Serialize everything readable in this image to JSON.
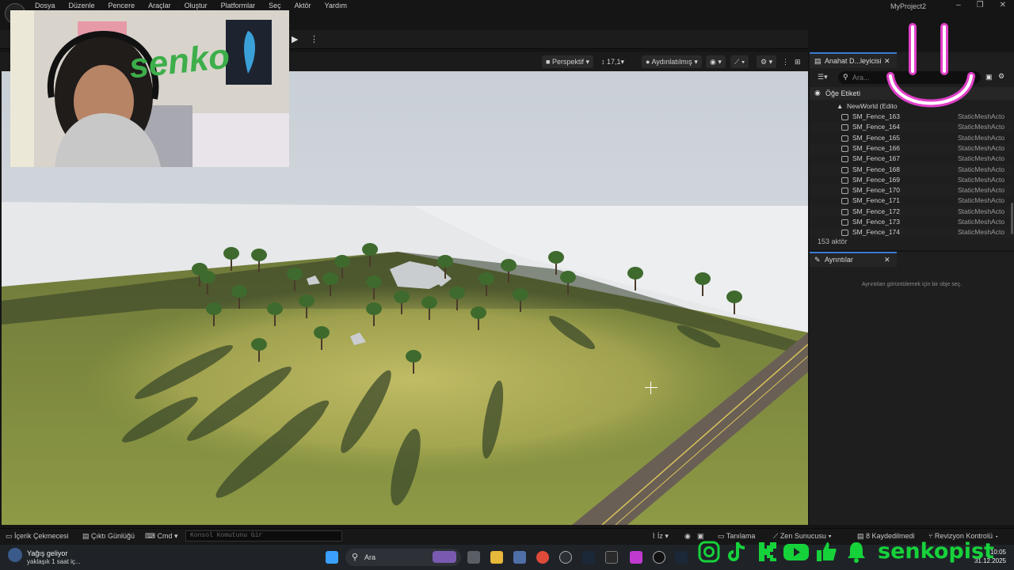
{
  "menu": [
    "Dosya",
    "Düzenle",
    "Pencere",
    "Araçlar",
    "Oluştur",
    "Platformlar",
    "Seç",
    "Aktör",
    "Yardım"
  ],
  "project_name": "MyProject2",
  "window_controls": [
    "–",
    "❐",
    "✕"
  ],
  "viewport": {
    "perspective": "Perspektif",
    "fov": "17,1",
    "lighting": "Aydınlatılmış"
  },
  "outliner": {
    "tab_title": "Anahat D...leyicisi",
    "search_placeholder": "Ara...",
    "column_label": "Öğe Etiketi",
    "world_label": "NewWorld (Edito",
    "rows": [
      {
        "name": "SM_Fence_163",
        "type": "StaticMeshActo"
      },
      {
        "name": "SM_Fence_164",
        "type": "StaticMeshActo"
      },
      {
        "name": "SM_Fence_165",
        "type": "StaticMeshActo"
      },
      {
        "name": "SM_Fence_166",
        "type": "StaticMeshActo"
      },
      {
        "name": "SM_Fence_167",
        "type": "StaticMeshActo"
      },
      {
        "name": "SM_Fence_168",
        "type": "StaticMeshActo"
      },
      {
        "name": "SM_Fence_169",
        "type": "StaticMeshActo"
      },
      {
        "name": "SM_Fence_170",
        "type": "StaticMeshActo"
      },
      {
        "name": "SM_Fence_171",
        "type": "StaticMeshActo"
      },
      {
        "name": "SM_Fence_172",
        "type": "StaticMeshActo"
      },
      {
        "name": "SM_Fence_173",
        "type": "StaticMeshActo"
      },
      {
        "name": "SM_Fence_174",
        "type": "StaticMeshActo"
      }
    ],
    "actor_count": "153 aktör"
  },
  "details": {
    "tab_title": "Ayrıntılar",
    "empty_message": "Ayrıntıları görüntülemek için bir obje seç."
  },
  "statusbar": {
    "content_drawer": "İçerik Çekmecesi",
    "output_log": "Çıktı Günlüğü",
    "cmd": "Cmd",
    "console_placeholder": "Konsol Komutunu Gir",
    "trace": "İz",
    "diagnostics": "Tanılama",
    "zen_server": "Zen Sunucusu",
    "unsaved": "8 Kaydedilmedi",
    "revision": "Revizyon Kontrolü"
  },
  "taskbar": {
    "weather_title": "Yağış geliyor",
    "weather_sub": "yaklaşık 1 saat iç...",
    "search_label": "Ara",
    "time": "10:05",
    "date": "31.12.2025"
  },
  "webcam_sign": "senko",
  "social_handle": "senkopist",
  "colors": {
    "accent": "#3a7bd5",
    "social_green": "#16d23a",
    "smiley_pink": "#e040c8"
  }
}
